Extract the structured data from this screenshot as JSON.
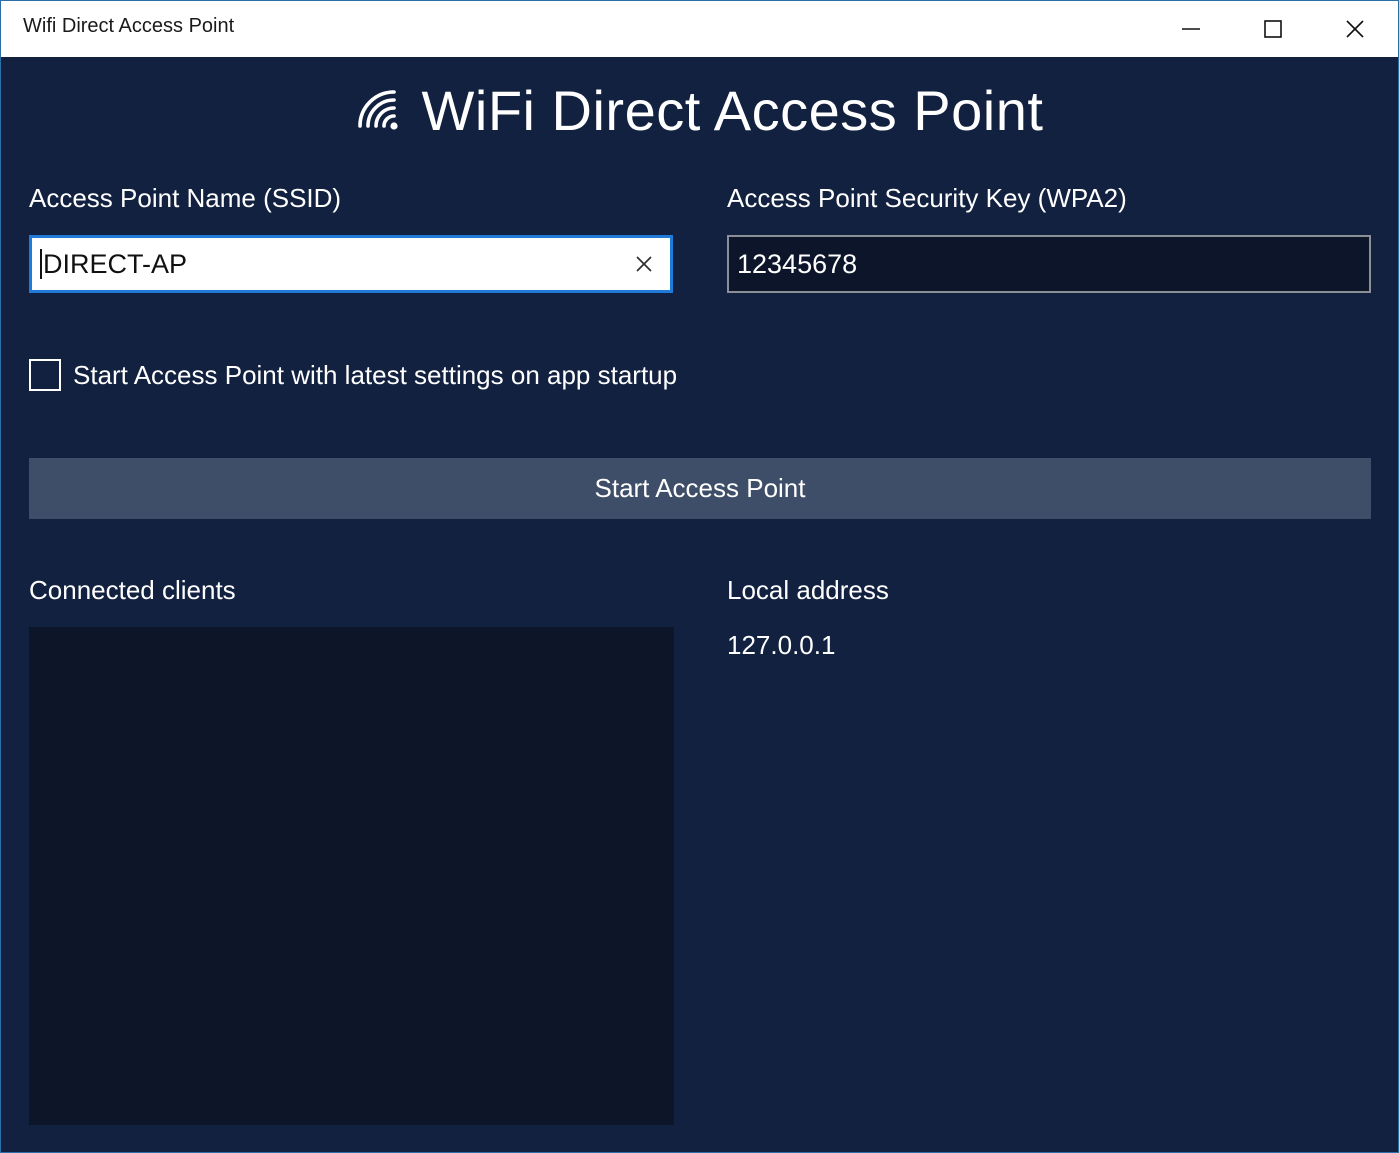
{
  "window": {
    "title": "Wifi Direct Access Point",
    "controls": {
      "minimize": "minimize-icon",
      "maximize": "maximize-icon",
      "close": "close-icon"
    }
  },
  "header": {
    "icon": "wifi-icon",
    "title": "WiFi Direct Access Point"
  },
  "ssid": {
    "label": "Access Point Name (SSID)",
    "value": "DIRECT-AP",
    "clear_icon": "clear-icon"
  },
  "security_key": {
    "label": "Access Point Security Key (WPA2)",
    "value": "12345678"
  },
  "startup_checkbox": {
    "label": "Start Access Point with latest settings on app startup",
    "checked": false
  },
  "start_button": {
    "label": "Start Access Point"
  },
  "clients": {
    "label": "Connected clients",
    "items": []
  },
  "local_address": {
    "label": "Local address",
    "value": "127.0.0.1"
  },
  "colors": {
    "background": "#12213f",
    "accent": "#1f7ad8",
    "button": "#3e4d68",
    "panel": "#0c1628"
  }
}
